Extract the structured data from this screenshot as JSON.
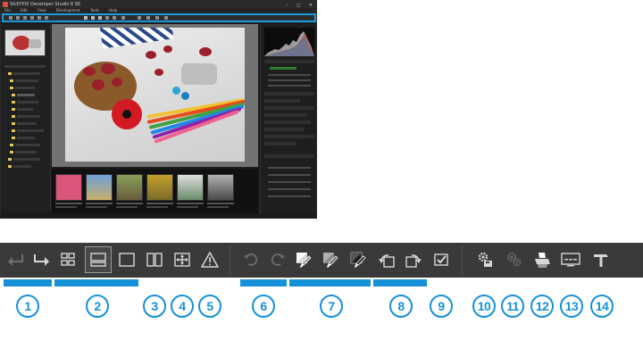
{
  "app": {
    "title": "SILKYPIX Developer Studio 8 SE",
    "menu": [
      "File",
      "Edit",
      "View",
      "Development",
      "Tools",
      "Help"
    ],
    "window_controls": "– ◻ ✕"
  },
  "toolbar": {
    "background": "#3a3a3a",
    "icon_color": "#d6d6d6",
    "disabled_color": "#6e6e6e",
    "accent": "#1591d8",
    "buttons": [
      {
        "name": "back-icon"
      },
      {
        "name": "forward-icon"
      },
      {
        "name": "thumbnail-grid-icon"
      },
      {
        "name": "preview-thumbnail-icon",
        "selected": true
      },
      {
        "name": "single-preview-icon"
      },
      {
        "name": "compare-icon"
      },
      {
        "name": "full-screen-icon"
      },
      {
        "name": "warning-icon"
      },
      {
        "name": "undo-icon"
      },
      {
        "name": "redo-icon"
      },
      {
        "name": "white-balance-picker-icon"
      },
      {
        "name": "gray-picker-icon"
      },
      {
        "name": "black-picker-icon"
      },
      {
        "name": "rotate-left-icon"
      },
      {
        "name": "rotate-right-icon"
      },
      {
        "name": "mark-check-icon"
      },
      {
        "name": "develop-icon"
      },
      {
        "name": "develop-all-icon"
      },
      {
        "name": "print-icon"
      },
      {
        "name": "display-settings-icon"
      },
      {
        "name": "hammer-tool-icon"
      }
    ]
  },
  "callouts": [
    "1",
    "2",
    "3",
    "4",
    "5",
    "6",
    "7",
    "8",
    "9",
    "10",
    "11",
    "12",
    "13",
    "14"
  ]
}
